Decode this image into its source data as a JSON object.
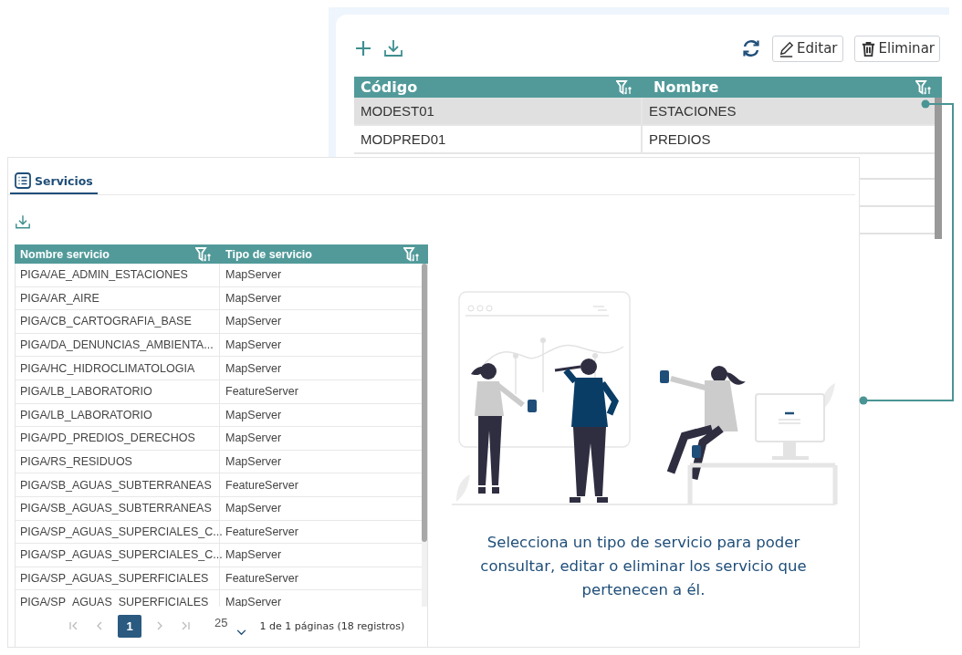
{
  "records_panel": {
    "buttons": [
      "Editar",
      "Eliminar"
    ],
    "table": {
      "columns": [
        "Código",
        "Nombre"
      ],
      "rows": [
        {
          "cells": [
            "MODEST01",
            "ESTACIONES"
          ],
          "selected": true
        },
        {
          "cells": [
            "MODPRED01",
            "PREDIOS"
          ],
          "selected": false
        }
      ]
    }
  },
  "services_panel": {
    "tabs": [
      {
        "label": "Servicios",
        "selected": true
      }
    ],
    "table": {
      "columns": [
        "Nombre servicio",
        "Tipo de servicio"
      ],
      "rows": [
        {
          "cells": [
            "PIGA/AE_ADMIN_ESTACIONES",
            "MapServer"
          ]
        },
        {
          "cells": [
            "PIGA/AR_AIRE",
            "MapServer"
          ]
        },
        {
          "cells": [
            "PIGA/CB_CARTOGRAFIA_BASE",
            "MapServer"
          ]
        },
        {
          "cells": [
            "PIGA/DA_DENUNCIAS_AMBIENTA...",
            "MapServer"
          ]
        },
        {
          "cells": [
            "PIGA/HC_HIDROCLIMATOLOGIA",
            "MapServer"
          ]
        },
        {
          "cells": [
            "PIGA/LB_LABORATORIO",
            "FeatureServer"
          ]
        },
        {
          "cells": [
            "PIGA/LB_LABORATORIO",
            "MapServer"
          ]
        },
        {
          "cells": [
            "PIGA/PD_PREDIOS_DERECHOS",
            "MapServer"
          ]
        },
        {
          "cells": [
            "PIGA/RS_RESIDUOS",
            "MapServer"
          ]
        },
        {
          "cells": [
            "PIGA/SB_AGUAS_SUBTERRANEAS",
            "FeatureServer"
          ]
        },
        {
          "cells": [
            "PIGA/SB_AGUAS_SUBTERRANEAS",
            "MapServer"
          ]
        },
        {
          "cells": [
            "PIGA/SP_AGUAS_SUPERCIALES_C...",
            "FeatureServer"
          ]
        },
        {
          "cells": [
            "PIGA/SP_AGUAS_SUPERCIALES_C...",
            "MapServer"
          ]
        },
        {
          "cells": [
            "PIGA/SP_AGUAS_SUPERFICIALES",
            "FeatureServer"
          ]
        },
        {
          "cells": [
            "PIGA/SP_AGUAS_SUPERFICIALES",
            "MapServer"
          ]
        }
      ]
    },
    "pagination": {
      "pages": [
        {
          "label": "1",
          "selected": true
        }
      ],
      "page_size": "25",
      "summary": "1 de 1 páginas (18 registros)"
    },
    "message": "Selecciona un tipo de servicio para poder consultar, editar o eliminar los servicio que pertenecen a él."
  }
}
